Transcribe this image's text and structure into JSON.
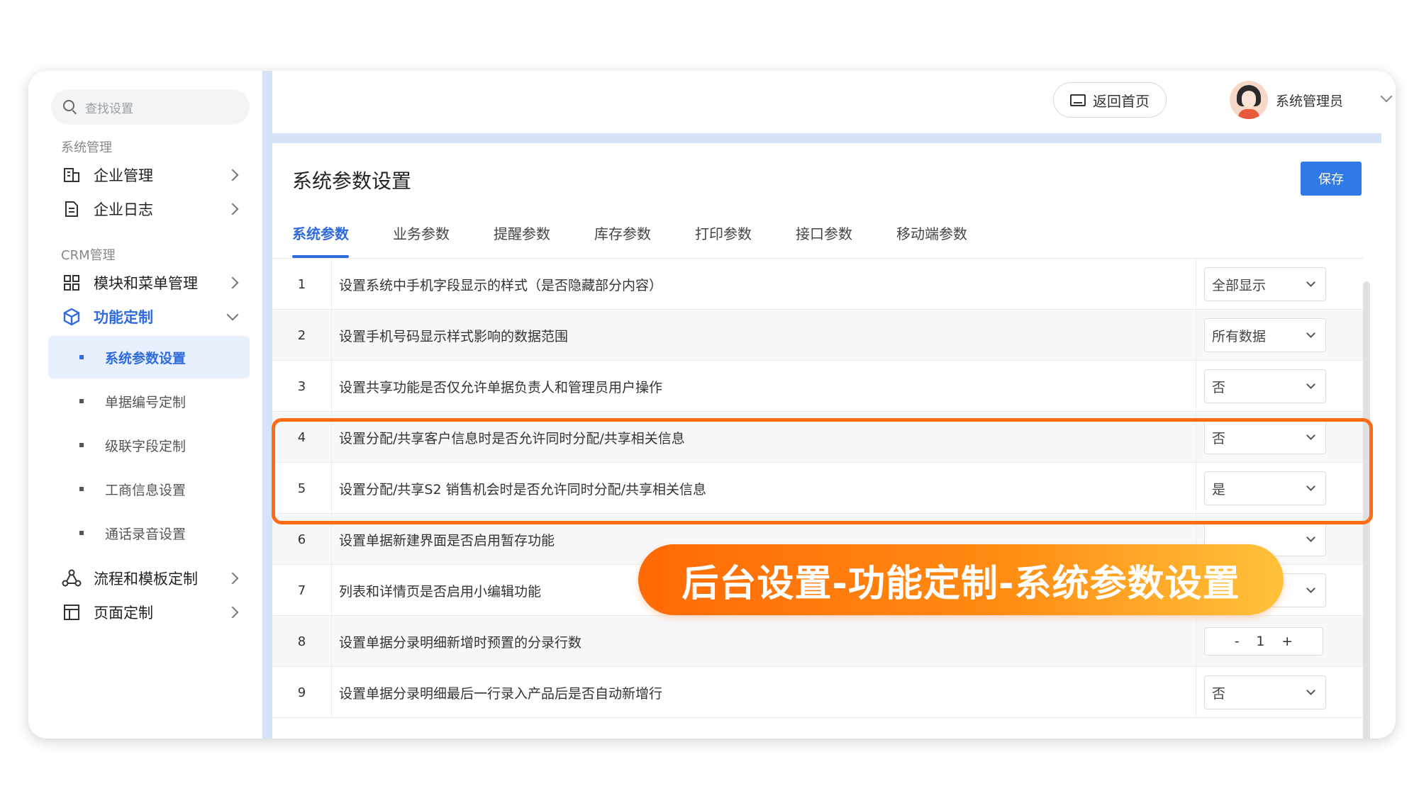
{
  "search": {
    "placeholder": "查找设置"
  },
  "sidebar": {
    "group_system": "系统管理",
    "group_crm": "CRM管理",
    "items": [
      {
        "label": "企业管理",
        "icon": "building-icon"
      },
      {
        "label": "企业日志",
        "icon": "document-icon"
      },
      {
        "label": "模块和菜单管理",
        "icon": "grid-icon"
      },
      {
        "label": "功能定制",
        "icon": "cube-icon"
      },
      {
        "label": "流程和模板定制",
        "icon": "flow-icon"
      },
      {
        "label": "页面定制",
        "icon": "layout-icon"
      }
    ],
    "subitems": [
      {
        "label": "系统参数设置"
      },
      {
        "label": "单据编号定制"
      },
      {
        "label": "级联字段定制"
      },
      {
        "label": "工商信息设置"
      },
      {
        "label": "通话录音设置"
      }
    ]
  },
  "header": {
    "home_label": "返回首页",
    "user_name": "系统管理员"
  },
  "page": {
    "title": "系统参数设置",
    "save_label": "保存",
    "tabs": [
      {
        "label": "系统参数"
      },
      {
        "label": "业务参数"
      },
      {
        "label": "提醒参数"
      },
      {
        "label": "库存参数"
      },
      {
        "label": "打印参数"
      },
      {
        "label": "接口参数"
      },
      {
        "label": "移动端参数"
      }
    ]
  },
  "rows": [
    {
      "num": "1",
      "desc": "设置系统中手机字段显示的样式（是否隐藏部分内容）",
      "value": "全部显示"
    },
    {
      "num": "2",
      "desc": "设置手机号码显示样式影响的数据范围",
      "value": "所有数据"
    },
    {
      "num": "3",
      "desc": "设置共享功能是否仅允许单据负责人和管理员用户操作",
      "value": "否"
    },
    {
      "num": "4",
      "desc": "设置分配/共享客户信息时是否允许同时分配/共享相关信息",
      "value": "否"
    },
    {
      "num": "5",
      "desc": "设置分配/共享S2 销售机会时是否允许同时分配/共享相关信息",
      "value": "是"
    },
    {
      "num": "6",
      "desc": "设置单据新建界面是否启用暂存功能",
      "value": ""
    },
    {
      "num": "7",
      "desc": "列表和详情页是否启用小编辑功能",
      "value": ""
    },
    {
      "num": "8",
      "desc": "设置单据分录明细新增时预置的分录行数",
      "stepper": {
        "minus": "-",
        "value": "1",
        "plus": "+"
      }
    },
    {
      "num": "9",
      "desc": "设置单据分录明细最后一行录入产品后是否自动新增行",
      "value": "否"
    }
  ],
  "banner": {
    "text": "后台设置-功能定制-系统参数设置"
  },
  "colors": {
    "accent": "#2f6bde",
    "highlight": "#ff6a13",
    "banner_start": "#ff6a06",
    "banner_end": "#ffc23a"
  }
}
